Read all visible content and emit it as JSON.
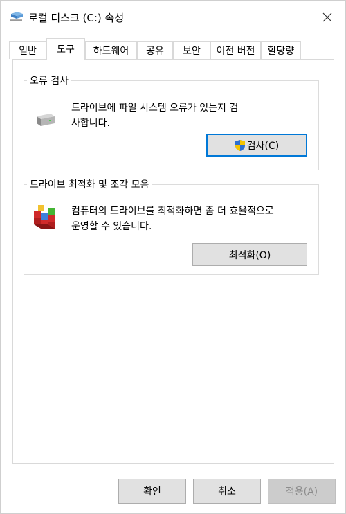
{
  "window": {
    "title": "로컬 디스크 (C:) 속성"
  },
  "tabs": [
    {
      "label": "일반"
    },
    {
      "label": "도구",
      "active": true
    },
    {
      "label": "하드웨어"
    },
    {
      "label": "공유"
    },
    {
      "label": "보안"
    },
    {
      "label": "이전 버전"
    },
    {
      "label": "할당량"
    }
  ],
  "error_check": {
    "title": "오류 검사",
    "line1": "드라이브에 파일 시스템 오류가 있는지 검",
    "line2": "사합니다.",
    "button_label": "검사(C)",
    "icon": "drive-icon"
  },
  "optimize": {
    "title": "드라이브 최적화 및 조각 모음",
    "line1": "컴퓨터의 드라이브를 최적화하면 좀 더 효율적으로",
    "line2": "운영할 수 있습니다.",
    "button_label": "최적화(O)",
    "icon": "defrag-icon"
  },
  "footer": {
    "ok_label": "확인",
    "cancel_label": "취소",
    "apply_label": "적용(A)",
    "apply_enabled": false
  }
}
